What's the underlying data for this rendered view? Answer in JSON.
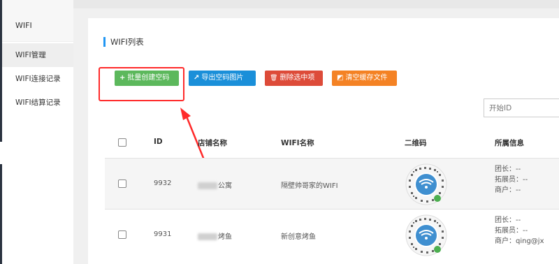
{
  "sidebar": {
    "title": "WIFI",
    "items": [
      {
        "label": "WIFI管理",
        "active": true
      },
      {
        "label": "WIFI连接记录",
        "active": false
      },
      {
        "label": "WIFI结算记录",
        "active": false
      }
    ]
  },
  "panel": {
    "title": "WIFI列表"
  },
  "toolbar": {
    "create_icon": "+",
    "create_label": "批量创建空码",
    "export_icon": "↗",
    "export_label": "导出空码图片",
    "delete_icon": "🗑",
    "delete_label": "删除选中项",
    "clear_icon": "◩",
    "clear_label": "清空缓存文件"
  },
  "search": {
    "start_id_placeholder": "开始ID"
  },
  "table": {
    "headers": {
      "id": "ID",
      "shop": "店铺名称",
      "wifi": "WIFI名称",
      "qrcode": "二维码",
      "info": "所属信息"
    },
    "rows": [
      {
        "id": "9932",
        "shop": "公寓",
        "wifi": "隔壁帅哥家的WIFI",
        "leader": "团长：--",
        "promoter": "拓展员：--",
        "merchant": "商户：--"
      },
      {
        "id": "9931",
        "shop": "烤鱼",
        "wifi": "新创意烤鱼",
        "leader": "团长：--",
        "promoter": "拓展员：--",
        "merchant": "商户：qing@jx"
      }
    ]
  },
  "colors": {
    "accent": "#2196f3",
    "green": "#5cb85c",
    "blue": "#1a8fd9",
    "red": "#dd4b39",
    "orange": "#f48224",
    "annotation": "#ff2a2a"
  }
}
